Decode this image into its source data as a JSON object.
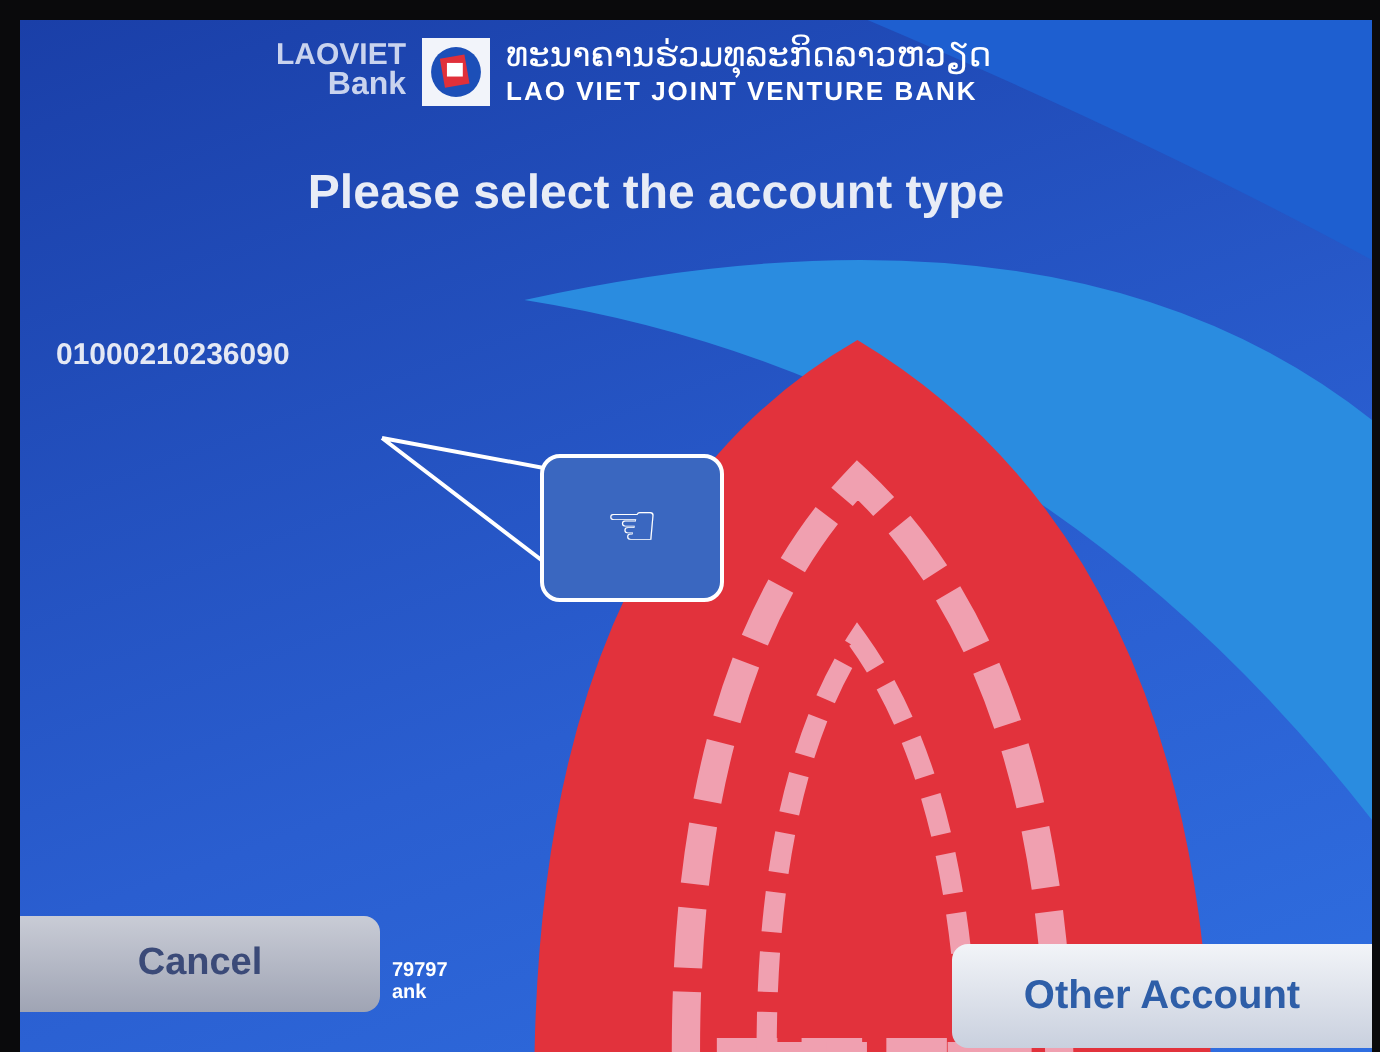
{
  "header": {
    "logo_line1": "LAOVIET",
    "logo_line2": "Bank",
    "lao_name": "ທະນາຄານຮ່ວມທຸລະກິດລາວຫວຽດ",
    "english_name": "LAO VIET JOINT VENTURE BANK"
  },
  "title": "Please select the account type",
  "accounts": [
    {
      "number": "01000210236090"
    }
  ],
  "callout": {
    "icon": "☜"
  },
  "footer_fragments": [
    "79797",
    "ank"
  ],
  "buttons": [
    {
      "label": "Cancel",
      "kind": "cancel"
    },
    {
      "label": "Other Account",
      "kind": "other"
    }
  ]
}
